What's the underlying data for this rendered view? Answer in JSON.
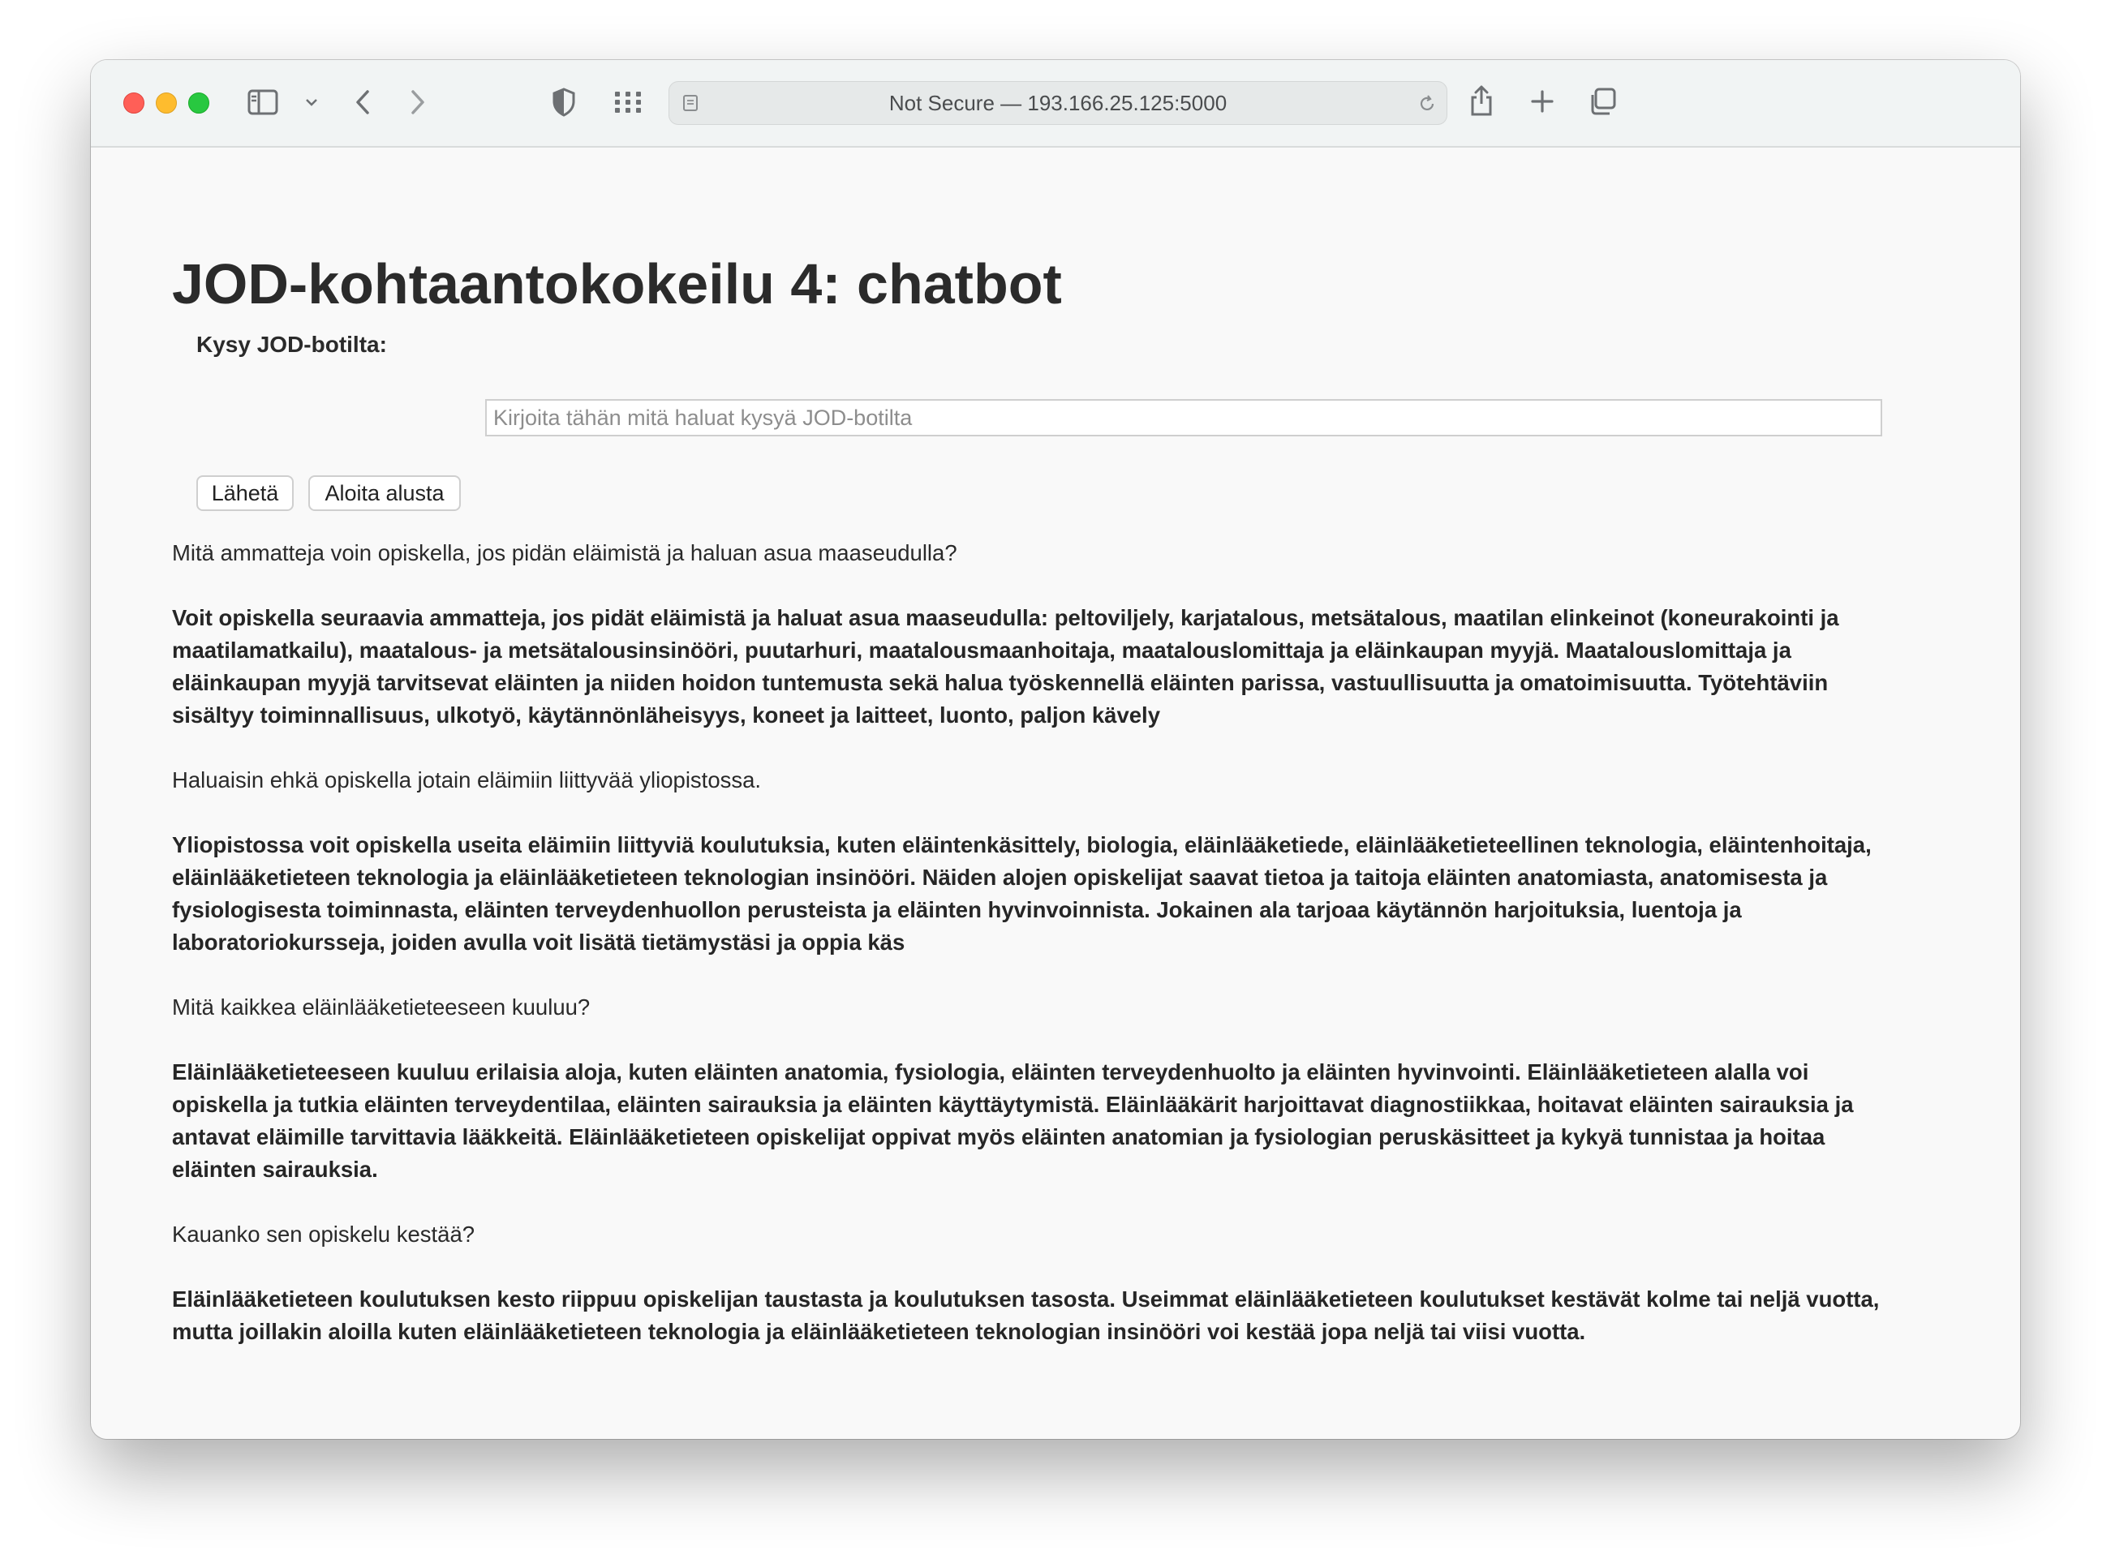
{
  "browser": {
    "address": "Not Secure — 193.166.25.125:5000"
  },
  "page": {
    "title": "JOD-kohtaantokokeilu 4: chatbot",
    "ask_label": "Kysy JOD-botilta:",
    "input_placeholder": "Kirjoita tähän mitä haluat kysyä JOD-botilta",
    "input_value": "",
    "send_label": "Lähetä",
    "reset_label": "Aloita alusta"
  },
  "conversation": [
    {
      "role": "user",
      "text": "Mitä ammatteja voin opiskella, jos pidän eläimistä ja haluan asua maaseudulla?"
    },
    {
      "role": "bot",
      "text": "Voit opiskella seuraavia ammatteja, jos pidät eläimistä ja haluat asua maaseudulla: peltoviljely, karjatalous, metsätalous, maatilan elinkeinot (koneurakointi ja maatilamatkailu), maatalous- ja metsätalousinsinööri, puutarhuri, maatalousmaanhoitaja, maatalouslomittaja ja eläinkaupan myyjä. Maatalouslomittaja ja eläinkaupan myyjä tarvitsevat eläinten ja niiden hoidon tuntemusta sekä halua työskennellä eläinten parissa, vastuullisuutta ja omatoimisuutta. Työtehtäviin sisältyy toiminnallisuus, ulkotyö, käytännönläheisyys, koneet ja laitteet, luonto, paljon kävely"
    },
    {
      "role": "user",
      "text": "Haluaisin ehkä opiskella jotain eläimiin liittyvää yliopistossa."
    },
    {
      "role": "bot",
      "text": "Yliopistossa voit opiskella useita eläimiin liittyviä koulutuksia, kuten eläintenkäsittely, biologia, eläinlääketiede, eläinlääketieteellinen teknologia, eläintenhoitaja, eläinlääketieteen teknologia ja eläinlääketieteen teknologian insinööri. Näiden alojen opiskelijat saavat tietoa ja taitoja eläinten anatomiasta, anatomisesta ja fysiologisesta toiminnasta, eläinten terveydenhuollon perusteista ja eläinten hyvinvoinnista. Jokainen ala tarjoaa käytännön harjoituksia, luentoja ja laboratoriokursseja, joiden avulla voit lisätä tietämystäsi ja oppia käs"
    },
    {
      "role": "user",
      "text": "Mitä kaikkea eläinlääketieteeseen kuuluu?"
    },
    {
      "role": "bot",
      "text": "Eläinlääketieteeseen kuuluu erilaisia aloja, kuten eläinten anatomia, fysiologia, eläinten terveydenhuolto ja eläinten hyvinvointi. Eläinlääketieteen alalla voi opiskella ja tutkia eläinten terveydentilaa, eläinten sairauksia ja eläinten käyttäytymistä. Eläinlääkärit harjoittavat diagnostiikkaa, hoitavat eläinten sairauksia ja antavat eläimille tarvittavia lääkkeitä. Eläinlääketieteen opiskelijat oppivat myös eläinten anatomian ja fysiologian peruskäsitteet ja kykyä tunnistaa ja hoitaa eläinten sairauksia."
    },
    {
      "role": "user",
      "text": "Kauanko sen opiskelu kestää?"
    },
    {
      "role": "bot",
      "text": "Eläinlääketieteen koulutuksen kesto riippuu opiskelijan taustasta ja koulutuksen tasosta. Useimmat eläinlääketieteen koulutukset kestävät kolme tai neljä vuotta, mutta joillakin aloilla kuten eläinlääketieteen teknologia ja eläinlääketieteen teknologian insinööri voi kestää jopa neljä tai viisi vuotta."
    }
  ],
  "icons": [
    "close-button",
    "minimize-button",
    "maximize-button",
    "sidebar-icon",
    "chevron-down-icon",
    "back-icon",
    "forward-icon",
    "privacy-shield-icon",
    "tab-grid-icon",
    "page-icon",
    "reload-icon",
    "share-icon",
    "new-tab-icon",
    "tabs-overview-icon"
  ]
}
